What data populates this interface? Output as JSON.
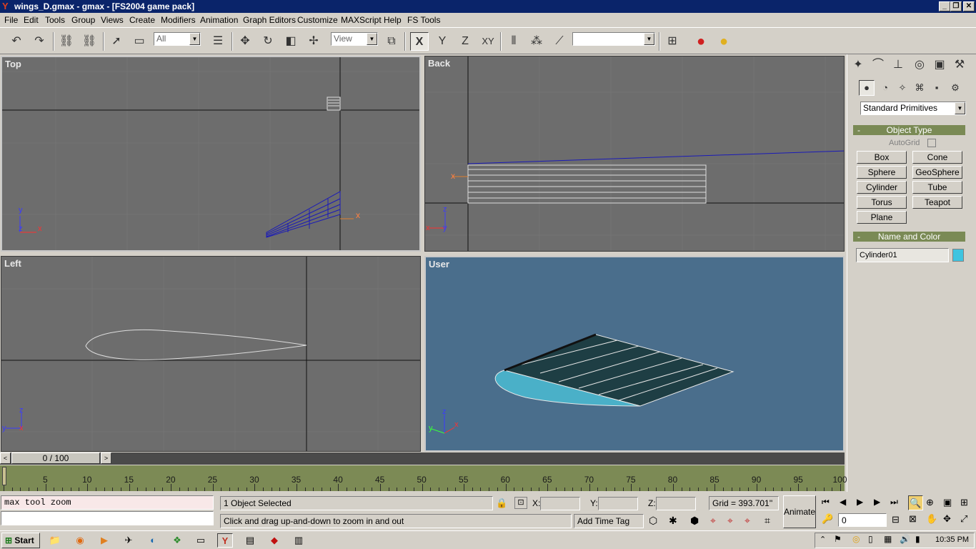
{
  "window": {
    "title": "wings_D.gmax - gmax - [FS2004 game pack]",
    "buttons": [
      "_",
      "❐",
      "✕"
    ]
  },
  "menu": [
    "File",
    "Edit",
    "Tools",
    "Group",
    "Views",
    "Create",
    "Modifiers",
    "Animation",
    "Graph Editors",
    "Customize",
    "MAXScript",
    "Help",
    "FS Tools"
  ],
  "toolbar": {
    "selection_filter": "All",
    "ref_coord": "View",
    "named_sel": "",
    "axes": [
      "X",
      "Y",
      "Z",
      "XY"
    ]
  },
  "viewports": {
    "top": {
      "label": "Top",
      "axis_y": "y",
      "axis_x": "x",
      "axis_z": "z",
      "gizmo_x": "x"
    },
    "back": {
      "label": "Back",
      "axis_z": "z",
      "axis_x": "x",
      "axis_y": "y",
      "gizmo_x": "x"
    },
    "left": {
      "label": "Left",
      "axis_z": "z",
      "axis_y": "y",
      "axis_x": "x"
    },
    "user": {
      "label": "User",
      "axis_z": "z",
      "axis_y": "y",
      "axis_x": "x"
    }
  },
  "command_panel": {
    "category_dropdown": "Standard Primitives",
    "object_type": {
      "header": "Object Type",
      "autogrid": "AutoGrid",
      "buttons": [
        "Box",
        "Cone",
        "Sphere",
        "GeoSphere",
        "Cylinder",
        "Tube",
        "Torus",
        "Teapot",
        "Plane"
      ]
    },
    "name_color": {
      "header": "Name and Color",
      "name": "Cylinder01",
      "color": "#3ec4e0"
    }
  },
  "timeline": {
    "slider": "0 / 100",
    "ticks": [
      "5",
      "10",
      "15",
      "20",
      "25",
      "30",
      "35",
      "40",
      "45",
      "50",
      "55",
      "60",
      "65",
      "70",
      "75",
      "80",
      "85",
      "90",
      "95",
      "100"
    ]
  },
  "status": {
    "maxscript": "max tool zoom",
    "selected": "1 Object Selected",
    "prompt": "Click and drag up-and-down to zoom in and out",
    "x_label": "X:",
    "y_label": "Y:",
    "z_label": "Z:",
    "grid": "Grid = 393.701''",
    "add_time_tag": "Add Time Tag",
    "animate": "Animate",
    "frame": "0"
  },
  "taskbar": {
    "start": "Start",
    "clock": "10:35 PM"
  }
}
